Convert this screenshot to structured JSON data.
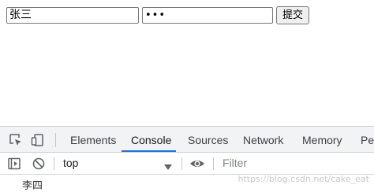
{
  "form": {
    "username_value": "张三",
    "password_value": "•••",
    "submit_label": "提交"
  },
  "devtools": {
    "tabs": [
      {
        "label": "Elements",
        "active": false
      },
      {
        "label": "Console",
        "active": true
      },
      {
        "label": "Sources",
        "active": false
      },
      {
        "label": "Network",
        "active": false
      },
      {
        "label": "Memory",
        "active": false
      },
      {
        "label": "Pe",
        "active": false
      }
    ],
    "icons": {
      "inspect": "inspect-element-icon",
      "device": "device-toolbar-icon",
      "sidebar": "console-sidebar-icon",
      "clear": "clear-console-icon",
      "eye": "live-expression-icon"
    },
    "context_value": "top",
    "filter_placeholder": "Filter",
    "console_output": [
      "李四"
    ],
    "accent_color": "#1a73e8"
  },
  "watermark": "https://blog.csdn.net/cake_eat"
}
